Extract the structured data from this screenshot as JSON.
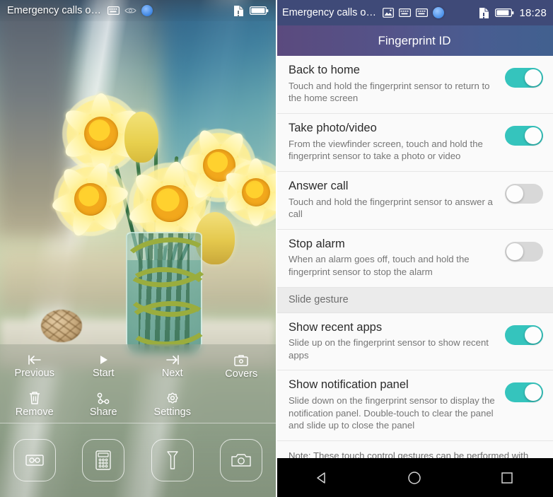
{
  "left_phone": {
    "status_bar": {
      "carrier_text": "Emergency calls o…",
      "icons": [
        "keyboard-icon",
        "eye-icon",
        "fingerprint-dot-icon"
      ],
      "right_icons": [
        "sd-card-icon",
        "battery-icon"
      ]
    },
    "gallery_menu": [
      {
        "label": "Previous",
        "icon": "previous-icon"
      },
      {
        "label": "Start",
        "icon": "play-icon"
      },
      {
        "label": "Next",
        "icon": "next-icon"
      },
      {
        "label": "Covers",
        "icon": "covers-icon"
      },
      {
        "label": "Remove",
        "icon": "trash-icon"
      },
      {
        "label": "Share",
        "icon": "share-icon"
      },
      {
        "label": "Settings",
        "icon": "gear-icon"
      }
    ],
    "shortcuts": [
      {
        "icon": "voice-recorder-icon"
      },
      {
        "icon": "calculator-icon"
      },
      {
        "icon": "flashlight-icon"
      },
      {
        "icon": "camera-icon"
      }
    ],
    "wallpaper_description": "yellow daffodils in a glass jar with green ribbon on a windowsill"
  },
  "right_phone": {
    "status_bar": {
      "carrier_text": "Emergency calls o…",
      "icons": [
        "screenshot-icon",
        "keyboard-icon",
        "keyboard-icon",
        "fingerprint-dot-icon"
      ],
      "right_icons": [
        "sd-card-icon",
        "battery-icon"
      ],
      "clock": "18:28"
    },
    "title": "Fingerprint ID",
    "settings": [
      {
        "title": "Back to home",
        "subtitle": "Touch and hold the fingerprint sensor to return to the home screen",
        "toggle": "on"
      },
      {
        "title": "Take photo/video",
        "subtitle": "From the viewfinder screen, touch and hold the fingerprint sensor to take a photo or video",
        "toggle": "on"
      },
      {
        "title": "Answer call",
        "subtitle": "Touch and hold the fingerprint sensor to answer a call",
        "toggle": "off"
      },
      {
        "title": "Stop alarm",
        "subtitle": "When an alarm goes off, touch and hold the fingerprint sensor to stop the alarm",
        "toggle": "off"
      }
    ],
    "section_header": "Slide gesture",
    "gesture_settings": [
      {
        "title": "Show recent apps",
        "subtitle": "Slide up on the fingerprint sensor to show recent apps",
        "toggle": "on"
      },
      {
        "title": "Show notification panel",
        "subtitle": "Slide down on the fingerprint sensor to display the notification panel. Double-touch to clear the panel and slide up to close the panel",
        "toggle": "on"
      }
    ],
    "note": "Note: These touch control gestures can be performed with any finger and do not require a fingerprint to be enrolled.",
    "navbar": [
      {
        "icon": "back-triangle-icon"
      },
      {
        "icon": "home-circle-icon"
      },
      {
        "icon": "recents-square-icon"
      }
    ]
  },
  "colors": {
    "toggle_on": "#35c4bd",
    "toggle_off": "#d8d8d8",
    "status_bar_bg": "#3f4a78",
    "title_gradient_start": "#5b4a7e",
    "title_gradient_end": "#41608f",
    "navbar_bg": "#000000"
  }
}
